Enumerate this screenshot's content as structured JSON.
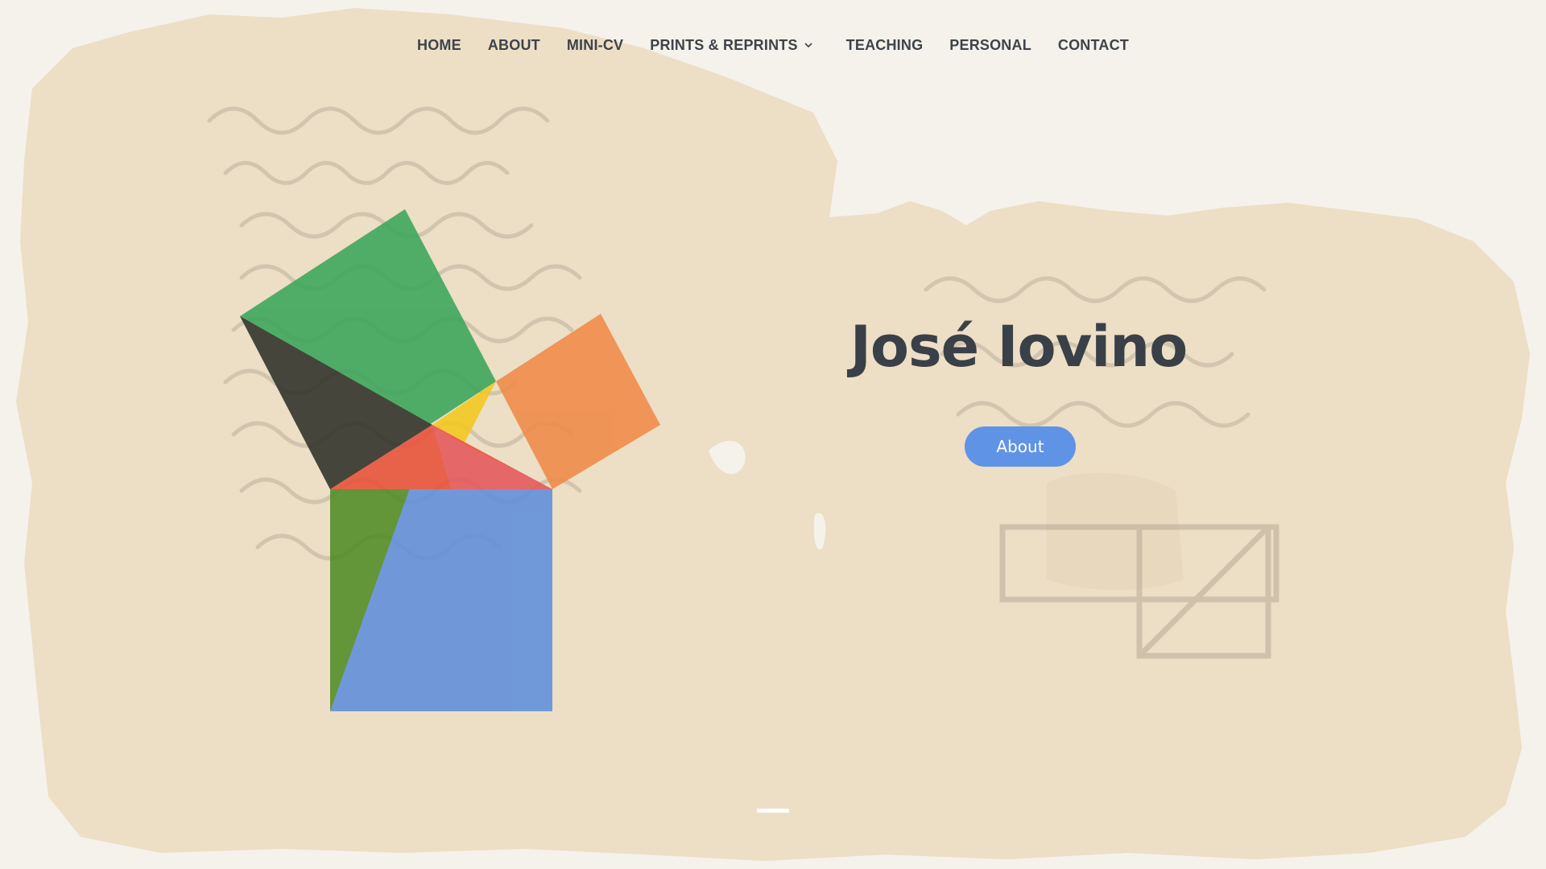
{
  "nav": {
    "items": [
      {
        "label": "HOME"
      },
      {
        "label": "ABOUT"
      },
      {
        "label": "MINI-CV"
      },
      {
        "label": "PRINTS & REPRINTS",
        "has_dropdown": true
      },
      {
        "label": "TEACHING"
      },
      {
        "label": "PERSONAL"
      },
      {
        "label": "CONTACT"
      }
    ]
  },
  "hero": {
    "title": "José Iovino",
    "button_label": "About"
  },
  "logo": {
    "icon": "pythagorean-theorem-icon",
    "colors": {
      "green": "#3aa65a",
      "dark": "#3a3a2e",
      "orange": "#f08a48",
      "yellow": "#f2c91d",
      "red": "#e8523a",
      "blue": "#5f8fdc",
      "olive": "#4f8d25"
    }
  },
  "background": {
    "icon": "papyrus-background-icon",
    "colors": {
      "page": "#f4f2ea",
      "papyrus": "#ecdcc4",
      "ink": "#a39885"
    }
  },
  "colors": {
    "accent": "#5f93e6",
    "nav_text": "#3d4349",
    "title_text": "#3a4047"
  }
}
